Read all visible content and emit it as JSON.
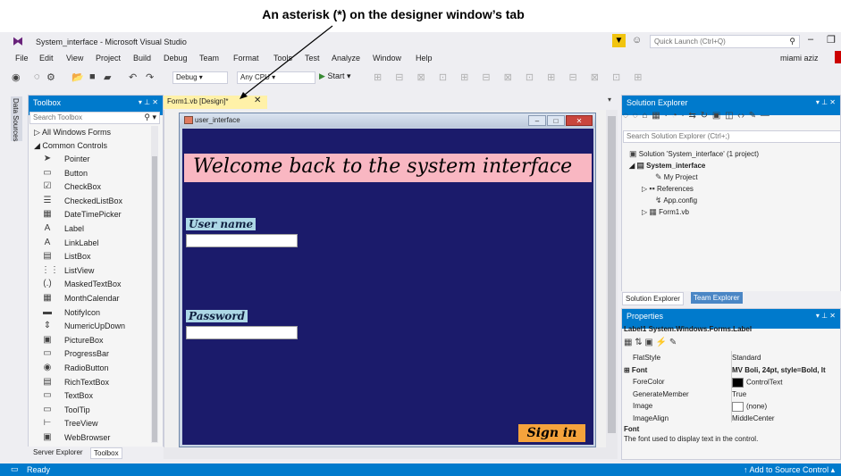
{
  "annotation": {
    "text": "An asterisk (*) on the designer window’s tab"
  },
  "app": {
    "title": "System_interface - Microsoft Visual Studio",
    "quick_launch_placeholder": "Quick Launch (Ctrl+Q)",
    "user": "miami aziz"
  },
  "menu": [
    "File",
    "Edit",
    "View",
    "Project",
    "Build",
    "Debug",
    "Team",
    "Format",
    "Tools",
    "Test",
    "Analyze",
    "Window",
    "Help"
  ],
  "toolbar": {
    "config": "Debug",
    "platform": "Any CPU",
    "start": "Start"
  },
  "side_strip": {
    "data_sources": "Data Sources"
  },
  "toolbox": {
    "title": "Toolbox",
    "search_placeholder": "Search Toolbox",
    "groups": {
      "all": "All Windows Forms",
      "common": "Common Controls"
    },
    "items": [
      {
        "label": "Pointer",
        "icon": "pointer-icon"
      },
      {
        "label": "Button",
        "icon": "button-icon"
      },
      {
        "label": "CheckBox",
        "icon": "checkbox-icon"
      },
      {
        "label": "CheckedListBox",
        "icon": "checkedlistbox-icon"
      },
      {
        "label": "DateTimePicker",
        "icon": "datetimepicker-icon"
      },
      {
        "label": "Label",
        "icon": "label-icon"
      },
      {
        "label": "LinkLabel",
        "icon": "linklabel-icon"
      },
      {
        "label": "ListBox",
        "icon": "listbox-icon"
      },
      {
        "label": "ListView",
        "icon": "listview-icon"
      },
      {
        "label": "MaskedTextBox",
        "icon": "maskedtextbox-icon"
      },
      {
        "label": "MonthCalendar",
        "icon": "monthcalendar-icon"
      },
      {
        "label": "NotifyIcon",
        "icon": "notifyicon-icon"
      },
      {
        "label": "NumericUpDown",
        "icon": "numericupdown-icon"
      },
      {
        "label": "PictureBox",
        "icon": "picturebox-icon"
      },
      {
        "label": "ProgressBar",
        "icon": "progressbar-icon"
      },
      {
        "label": "RadioButton",
        "icon": "radiobutton-icon"
      },
      {
        "label": "RichTextBox",
        "icon": "richtextbox-icon"
      },
      {
        "label": "TextBox",
        "icon": "textbox-icon"
      },
      {
        "label": "ToolTip",
        "icon": "tooltip-icon"
      },
      {
        "label": "TreeView",
        "icon": "treeview-icon"
      },
      {
        "label": "WebBrowser",
        "icon": "webbrowser-icon"
      }
    ],
    "bottom_tabs": [
      "Server Explorer",
      "Toolbox"
    ]
  },
  "document": {
    "tab_label": "Form1.vb [Design]*",
    "form": {
      "title": "user_interface",
      "welcome": "Welcome back to the system interface",
      "username_label": "User name",
      "password_label": "Password",
      "signin": "Sign in"
    }
  },
  "solution_explorer": {
    "title": "Solution Explorer",
    "search_placeholder": "Search Solution Explorer (Ctrl+;)",
    "tree": {
      "solution": "Solution 'System_interface' (1 project)",
      "project": "System_interface",
      "my_project": "My Project",
      "references": "References",
      "app_config": "App.config",
      "form1": "Form1.vb"
    },
    "tabs": [
      "Solution Explorer",
      "Team Explorer"
    ]
  },
  "properties": {
    "title": "Properties",
    "object": "Label1 System.Windows.Forms.Label",
    "rows": [
      {
        "name": "FlatStyle",
        "value": "Standard"
      },
      {
        "name": "Font",
        "value": "MV Boli, 24pt, style=Bold, It"
      },
      {
        "name": "ForeColor",
        "value": "ControlText"
      },
      {
        "name": "GenerateMember",
        "value": "True"
      },
      {
        "name": "Image",
        "value": "(none)"
      },
      {
        "name": "ImageAlign",
        "value": "MiddleCenter"
      }
    ],
    "desc_title": "Font",
    "desc_text": "The font used to display text in the control."
  },
  "status": {
    "left": "Ready",
    "right": "Add to Source Control"
  },
  "colors": {
    "accent": "#007acc",
    "form_background": "#1b1b6b",
    "welcome_background": "#f9b7c2",
    "label_background": "#add8e6",
    "signin_background": "#f5a33c",
    "tab_active": "#fff1a8"
  }
}
